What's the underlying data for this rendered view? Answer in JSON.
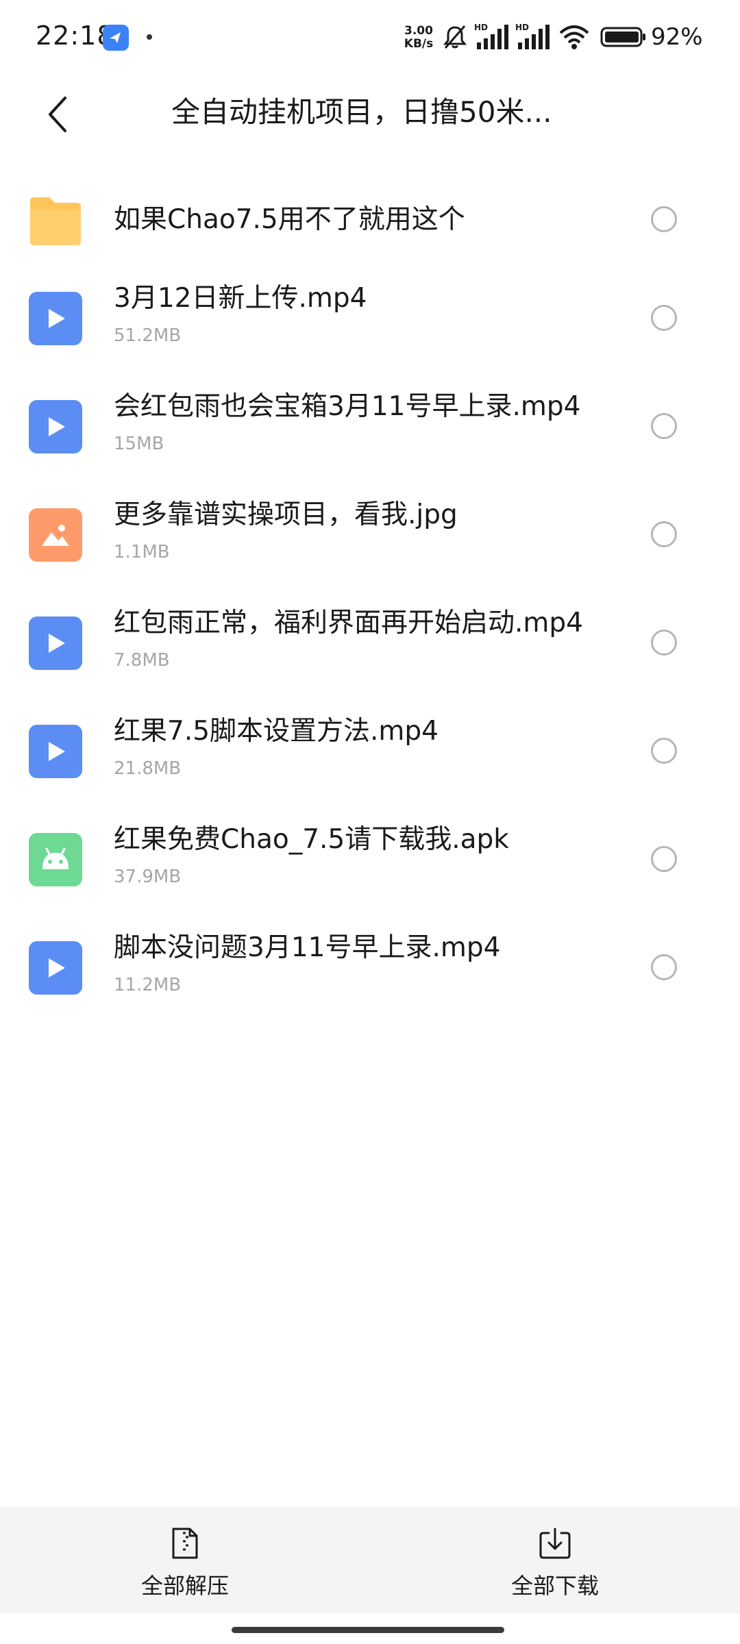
{
  "status_bar": {
    "time": "22:18",
    "network_speed_value": "3.00",
    "network_speed_unit": "KB/s",
    "battery_percent": "92%",
    "icons": [
      "app-notification-icon",
      "mute-icon",
      "signal-hd-icon",
      "signal-hd-icon",
      "wifi-icon",
      "battery-icon"
    ]
  },
  "header": {
    "title": "全自动挂机项目，日撸50米..."
  },
  "files": [
    {
      "name": "如果Chao7.5用不了就用这个",
      "size": "",
      "type": "folder",
      "icon": "folder-icon",
      "color": "#FFC55A"
    },
    {
      "name": "3月12日新上传.mp4",
      "size": "51.2MB",
      "type": "video",
      "icon": "video-play-icon",
      "color": "#5B8DF5"
    },
    {
      "name": "会红包雨也会宝箱3月11号早上录.mp4",
      "size": "15MB",
      "type": "video",
      "icon": "video-play-icon",
      "color": "#5B8DF5"
    },
    {
      "name": "更多靠谱实操项目，看我.jpg",
      "size": "1.1MB",
      "type": "image",
      "icon": "image-icon",
      "color": "#FF9A6A"
    },
    {
      "name": "红包雨正常，福利界面再开始启动.mp4",
      "size": "7.8MB",
      "type": "video",
      "icon": "video-play-icon",
      "color": "#5B8DF5"
    },
    {
      "name": "红果7.5脚本设置方法.mp4",
      "size": "21.8MB",
      "type": "video",
      "icon": "video-play-icon",
      "color": "#5B8DF5"
    },
    {
      "name": "红果免费Chao_7.5请下载我.apk",
      "size": "37.9MB",
      "type": "apk",
      "icon": "android-icon",
      "color": "#6DD993"
    },
    {
      "name": "脚本没问题3月11号早上录.mp4",
      "size": "11.2MB",
      "type": "video",
      "icon": "video-play-icon",
      "color": "#5B8DF5"
    }
  ],
  "bottom_bar": {
    "extract_all_label": "全部解压",
    "download_all_label": "全部下载"
  }
}
